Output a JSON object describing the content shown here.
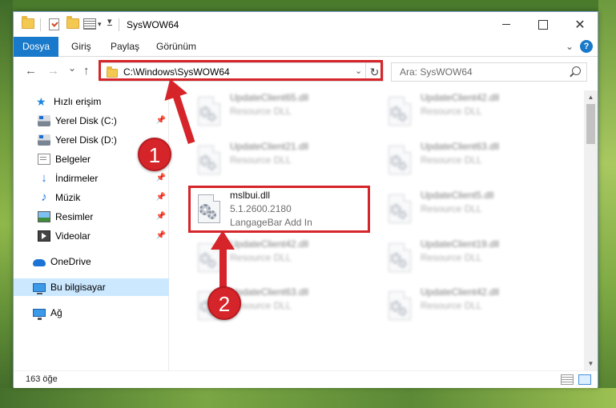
{
  "window": {
    "title": "SysWOW64",
    "controls": {
      "minimize": "",
      "maximize": "",
      "close": "✕"
    }
  },
  "ribbon": {
    "tabs": [
      "Dosya",
      "Giriş",
      "Paylaş",
      "Görünüm"
    ],
    "help": "?"
  },
  "navigation": {
    "back": "←",
    "forward": "→",
    "recent": "⌄",
    "up": "↑",
    "address": "C:\\Windows\\SysWOW64",
    "refresh": "↻",
    "search_placeholder": "Ara: SysWOW64"
  },
  "sidebar": {
    "items": [
      {
        "label": "Hızlı erişim",
        "icon": "star-icon",
        "pinned": false
      },
      {
        "label": "Yerel Disk (C:)",
        "icon": "drive-icon",
        "pinned": true
      },
      {
        "label": "Yerel Disk (D:)",
        "icon": "drive-icon",
        "pinned": false
      },
      {
        "label": "Belgeler",
        "icon": "documents-icon",
        "pinned": true
      },
      {
        "label": "İndirmeler",
        "icon": "downloads-icon",
        "pinned": true
      },
      {
        "label": "Müzik",
        "icon": "music-icon",
        "pinned": true
      },
      {
        "label": "Resimler",
        "icon": "pictures-icon",
        "pinned": true
      },
      {
        "label": "Videolar",
        "icon": "videos-icon",
        "pinned": true
      },
      {
        "label": "OneDrive",
        "icon": "onedrive-icon",
        "pinned": false
      },
      {
        "label": "Bu bilgisayar",
        "icon": "this-pc-icon",
        "pinned": false,
        "selected": true
      },
      {
        "label": "Ağ",
        "icon": "network-icon",
        "pinned": false
      }
    ],
    "pin_glyph": "📌"
  },
  "files": [
    {
      "name": "UpdateClient65.dll",
      "type": "Resource DLL",
      "blurred": true
    },
    {
      "name": "UpdateClient42.dll",
      "type": "Resource DLL",
      "blurred": true
    },
    {
      "name": "UpdateClient21.dll",
      "type": "Resource DLL",
      "blurred": true
    },
    {
      "name": "UpdateClient63.dll",
      "type": "Resource DLL",
      "blurred": true
    },
    {
      "name": "mslbui.dll",
      "type": "5.1.2600.2180",
      "description": "LangageBar Add In",
      "blurred": false,
      "highlighted": true
    },
    {
      "name": "UpdateClient5.dll",
      "type": "Resource DLL",
      "blurred": true
    },
    {
      "name": "UpdateClient42.dll",
      "type": "Resource DLL",
      "blurred": true
    },
    {
      "name": "UpdateClient19.dll",
      "type": "Resource DLL",
      "blurred": true
    },
    {
      "name": "UpdateClient63.dll",
      "type": "Resource DLL",
      "blurred": true
    },
    {
      "name": "UpdateClient42.dll",
      "type": "Resource DLL",
      "blurred": true
    }
  ],
  "status": {
    "item_count": "163 öğe"
  },
  "annotations": {
    "step1": "1",
    "step2": "2",
    "color": "#d6252a"
  }
}
